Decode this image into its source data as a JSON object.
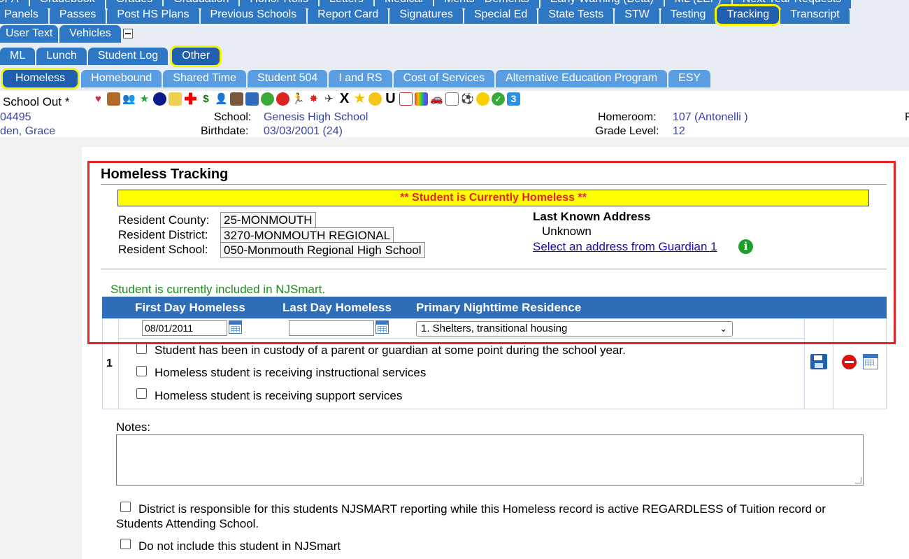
{
  "tabs": {
    "row0": [
      "GPA",
      "Gradebook",
      "Grades",
      "Graduation",
      "Honor Rolls",
      "Letters",
      "Medical",
      "Merits - Demerits",
      "Early Warning (Beta)",
      "ML (LEP)",
      "Next Year Requests"
    ],
    "row1": [
      "Panels",
      "Passes",
      "Post HS Plans",
      "Previous Schools",
      "Report Card",
      "Signatures",
      "Special Ed",
      "State Tests",
      "STW",
      "Testing",
      "Tracking",
      "Transcript"
    ],
    "row2": [
      "User Text",
      "Vehicles"
    ],
    "row3": [
      "ML",
      "Lunch",
      "Student Log",
      "Other"
    ],
    "row4": [
      "Homeless",
      "Homebound",
      "Shared Time",
      "Student 504",
      "I and RS",
      "Cost of Services",
      "Alternative Education Program",
      "ESY"
    ]
  },
  "active_tabs": {
    "row1": "Tracking",
    "row3": "Other",
    "row4": "Homeless"
  },
  "student": {
    "school_out_label": "School Out *",
    "id_partial": "04495",
    "name_partial": "den, Grace",
    "school_label": "School:",
    "school_value": "Genesis High School",
    "birthdate_label": "Birthdate:",
    "birthdate_value": "03/03/2001 (24)",
    "homeroom_label": "Homeroom:",
    "homeroom_value": "107 (Antonelli )",
    "grade_label": "Grade Level:",
    "grade_value": "12",
    "trailing_char": "F"
  },
  "status_icons": [
    "heart-icon",
    "briefcase-icon",
    "people-icon",
    "star-icon",
    "blue-dot-icon",
    "folder-icon",
    "red-cross-icon",
    "dollar-icon",
    "person-icon",
    "graduate-icon",
    "book-icon",
    "speech-icon",
    "no-icon",
    "runner-icon",
    "burst-icon",
    "plane-icon",
    "x-icon",
    "gold-star-icon",
    "smiley-icon",
    "u-icon",
    "card-icon",
    "rainbow-icon",
    "car-icon",
    "certificate-icon",
    "soccer-icon",
    "circle-icon",
    "check-icon",
    "number-3-icon"
  ],
  "homeless": {
    "title": "Homeless Tracking",
    "banner": "** Student is Currently Homeless **",
    "resident_county_label": "Resident County:",
    "resident_county_value": "25-MONMOUTH",
    "resident_district_label": "Resident District:",
    "resident_district_value": "3270-MONMOUTH REGIONAL",
    "resident_school_label": "Resident School:",
    "resident_school_value": "050-Monmouth Regional High School",
    "last_known_address_label": "Last Known Address",
    "last_known_address_value": "Unknown",
    "select_address_link": "Select an address from Guardian 1",
    "njsmart_status": "Student is currently included in NJSmart.",
    "columns": [
      "First Day Homeless",
      "Last Day Homeless",
      "Primary Nighttime Residence"
    ],
    "row_number": "1",
    "first_day_value": "08/01/2011",
    "last_day_value": "",
    "residence_value": "1. Shelters, transitional housing",
    "checkboxes": [
      "Student has been in custody of a parent or guardian at some point during the school year.",
      "Homeless student is receiving instructional services",
      "Homeless student is receiving support services"
    ],
    "notes_label": "Notes:",
    "notes_value": "",
    "district_responsible_text": "District is responsible for this students NJSMART reporting while this Homeless record is active REGARDLESS of Tuition record or Students Attending School.",
    "exclude_njsmart_text": "Do not include this student in NJSmart"
  },
  "colors": {
    "tab": "#2e77c5",
    "highlight": "#f5f500",
    "annotation_box": "#e3242b",
    "banner_bg": "#ffff00",
    "table_header": "#2e6db8"
  }
}
